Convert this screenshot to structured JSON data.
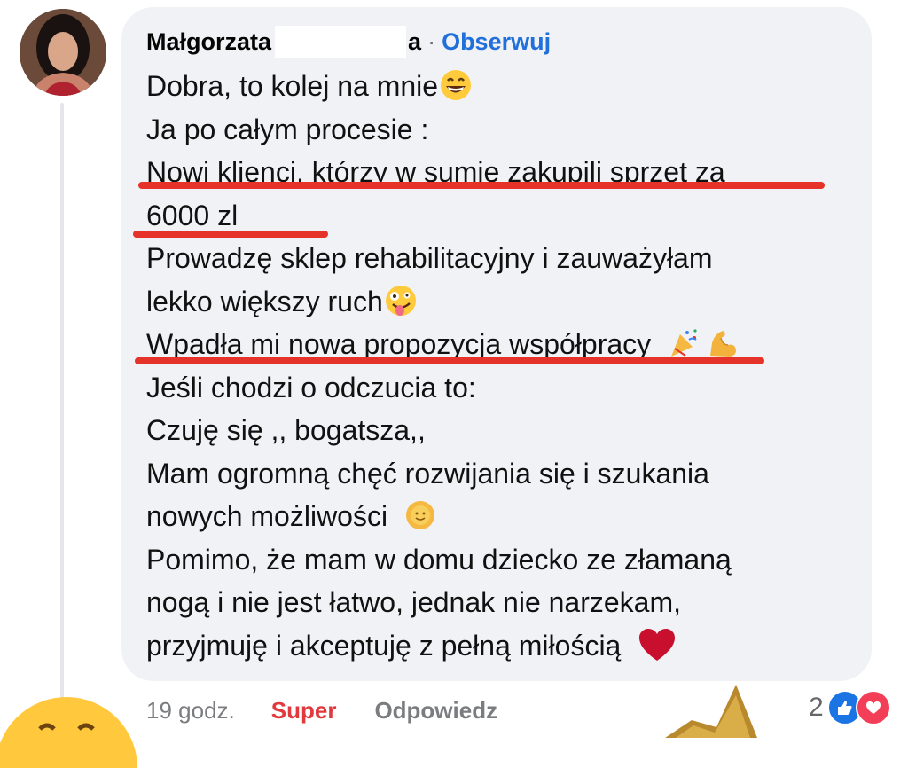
{
  "comment": {
    "author_first": "Małgorzata",
    "author_last_tail": "a",
    "separator": "·",
    "follow_label": "Obserwuj",
    "lines": [
      "Dobra, to kolej na mnie",
      "Ja po całym procesie :",
      "Nowi klienci, którzy w sumie zakupili sprzęt za",
      "6000 zl",
      "Prowadzę sklep rehabilitacyjny i zauważyłam",
      "lekko większy ruch",
      "Wpadła mi nowa propozycja współpracy",
      "Jeśli chodzi o odczucia to:",
      "Czuję się ,, bogatsza,,",
      "Mam ogromną chęć rozwijania się i szukania",
      "nowych możliwości",
      "Pomimo, że mam w domu dziecko ze złamaną",
      "nogą i nie jest łatwo, jednak nie narzekam,",
      "przyjmuję i akceptuję z pełną miłością"
    ],
    "emoji_names": [
      "grinning-face-icon",
      "zany-face-icon",
      "party-popper-icon",
      "flexed-biceps-icon",
      "sun-face-icon",
      "red-heart-icon"
    ]
  },
  "footer": {
    "time": "19 godz.",
    "super_label": "Super",
    "reply_label": "Odpowiedz",
    "reaction_count": "2"
  },
  "colors": {
    "bubble": "#f0f2f5",
    "link_blue": "#216fdb",
    "super_red": "#e0393e",
    "underline_red": "#e5332a",
    "muted": "#7a7c80"
  }
}
